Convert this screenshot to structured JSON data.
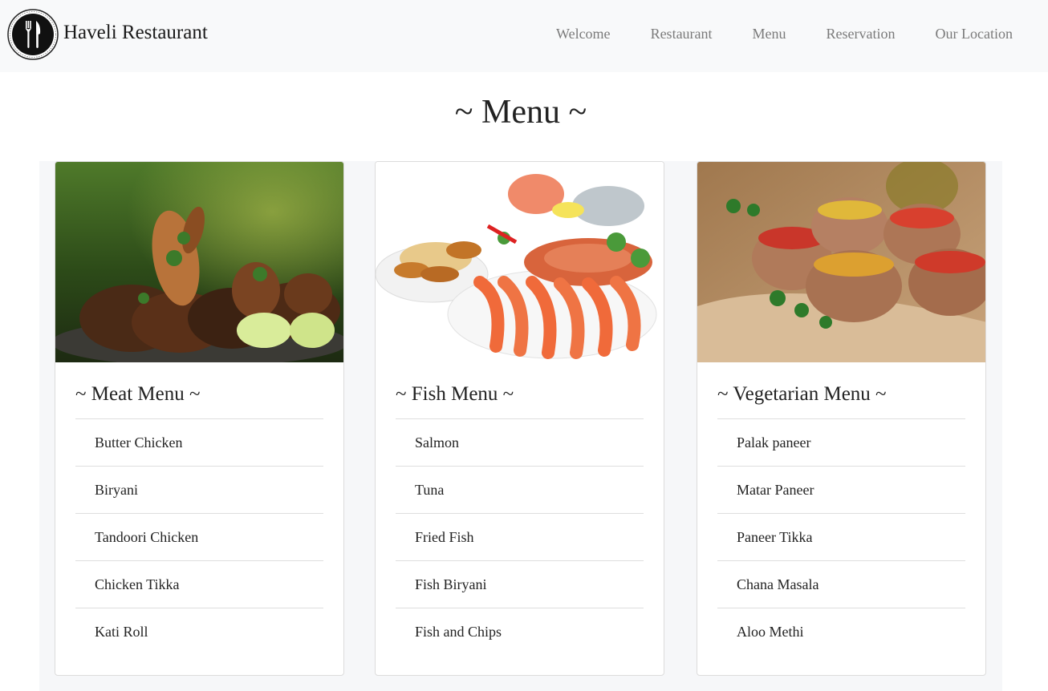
{
  "brand": {
    "name": "Haveli Restaurant",
    "logo_icon": "fork-knife-plate-icon"
  },
  "nav": {
    "items": [
      "Welcome",
      "Restaurant",
      "Menu",
      "Reservation",
      "Our Location"
    ]
  },
  "page": {
    "title": "~ Menu ~"
  },
  "menus": [
    {
      "title": "~ Meat Menu ~",
      "image": "grilled-chicken-photo",
      "items": [
        "Butter Chicken",
        "Biryani",
        "Tandoori Chicken",
        "Chicken Tikka",
        "Kati Roll"
      ]
    },
    {
      "title": "~ Fish Menu ~",
      "image": "seafood-platter-photo",
      "items": [
        "Salmon",
        "Tuna",
        "Fried Fish",
        "Fish Biryani",
        "Fish and Chips"
      ]
    },
    {
      "title": "~ Vegetarian Menu ~",
      "image": "stuffed-mushrooms-photo",
      "items": [
        "Palak paneer",
        "Matar Paneer",
        "Paneer Tikka",
        "Chana Masala",
        "Aloo Methi"
      ]
    }
  ],
  "colors": {
    "navbar_bg": "#f8f9fa",
    "nav_link": "#7a7a7a",
    "divider": "#dedede"
  }
}
